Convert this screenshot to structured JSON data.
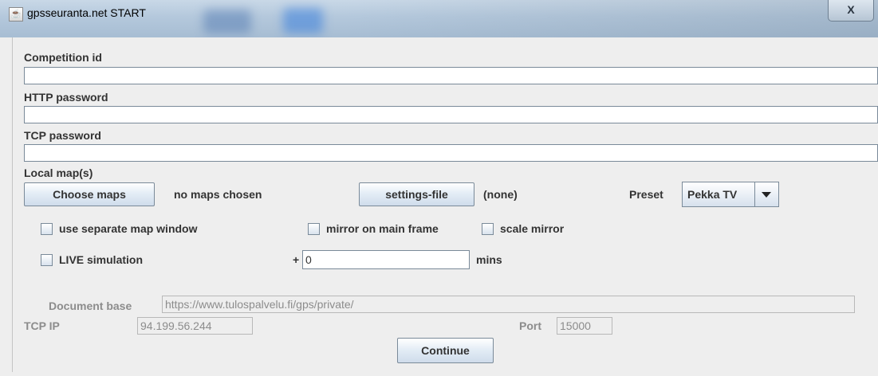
{
  "window": {
    "title": "gpsseuranta.net START",
    "close_glyph": "X",
    "icon": "java-icon"
  },
  "form": {
    "competition_id_label": "Competition id",
    "competition_id_value": "",
    "http_password_label": "HTTP password",
    "http_password_value": "",
    "tcp_password_label": "TCP password",
    "tcp_password_value": "",
    "local_maps_label": "Local map(s)",
    "choose_maps_button": "Choose maps",
    "maps_status": "no maps chosen",
    "settings_file_button": "settings-file",
    "settings_file_status": "(none)",
    "preset_label": "Preset",
    "preset_value": "Pekka TV",
    "use_separate_map_window": "use separate map window",
    "mirror_on_main_frame": "mirror on main frame",
    "scale_mirror": "scale mirror",
    "live_simulation": "LIVE simulation",
    "offset_prefix": "+",
    "offset_value": "0",
    "offset_unit": "mins",
    "document_base_label": "Document base",
    "document_base_value": "https://www.tulospalvelu.fi/gps/private/",
    "tcp_ip_label": "TCP IP",
    "tcp_ip_value": "94.199.56.244",
    "port_label": "Port",
    "port_value": "15000",
    "continue_button": "Continue"
  },
  "checkboxes_checked": {
    "use_separate_map_window": false,
    "mirror_on_main_frame": false,
    "scale_mirror": false,
    "live_simulation": false
  }
}
